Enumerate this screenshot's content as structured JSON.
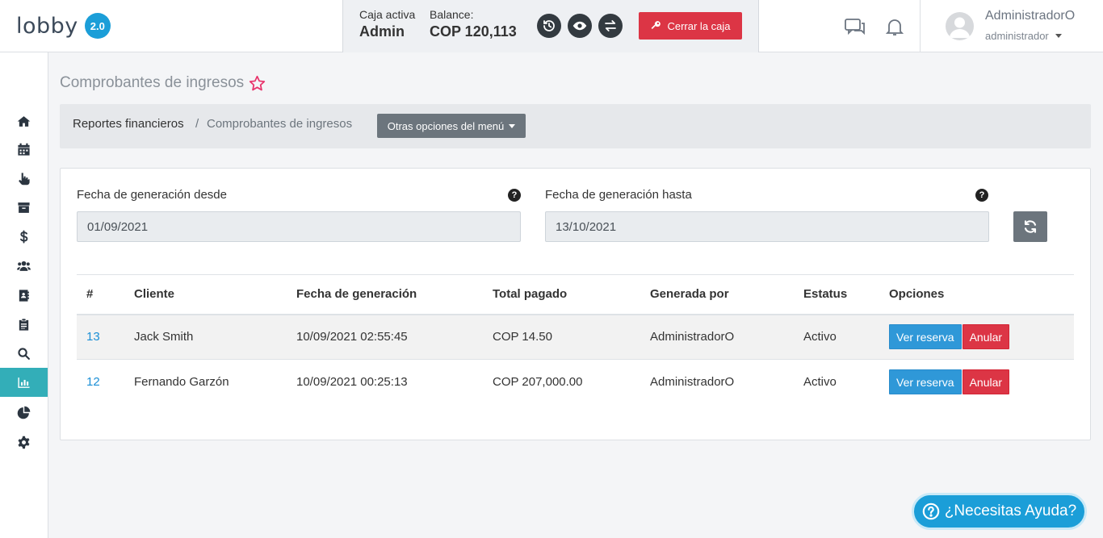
{
  "app": {
    "logo_text": "lobby",
    "version_badge": "2.0"
  },
  "cashbox": {
    "active_label": "Caja activa",
    "active_value": "Admin",
    "balance_label": "Balance:",
    "balance_value": "COP 120,113",
    "close_button": "Cerrar la caja"
  },
  "user": {
    "name": "AdministradorO",
    "role": "administrador"
  },
  "page": {
    "title": "Comprobantes de ingresos"
  },
  "breadcrumb": {
    "items": [
      "Reportes financieros",
      "Comprobantes de ingresos"
    ],
    "separator": "/",
    "menu_button": "Otras opciones del menú"
  },
  "filters": {
    "from_label": "Fecha de generación desde",
    "from_value": "01/09/2021",
    "to_label": "Fecha de generación hasta",
    "to_value": "13/10/2021",
    "help_glyph": "?"
  },
  "table": {
    "headers": [
      "#",
      "Cliente",
      "Fecha de generación",
      "Total pagado",
      "Generada por",
      "Estatus",
      "Opciones"
    ],
    "rows": [
      {
        "id": "13",
        "client": "Jack Smith",
        "date": "10/09/2021 02:55:45",
        "total": "COP 14.50",
        "by": "AdministradorO",
        "status": "Activo"
      },
      {
        "id": "12",
        "client": "Fernando Garzón",
        "date": "10/09/2021 00:25:13",
        "total": "COP 207,000.00",
        "by": "AdministradorO",
        "status": "Activo"
      }
    ],
    "view_button": "Ver reserva",
    "void_button": "Anular"
  },
  "help_fab": {
    "label": "¿Necesitas Ayuda?"
  },
  "colors": {
    "brand": "#1b9ed8",
    "sidebar_active": "#33aeb8",
    "danger": "#dc3545",
    "secondary": "#6c757d"
  }
}
